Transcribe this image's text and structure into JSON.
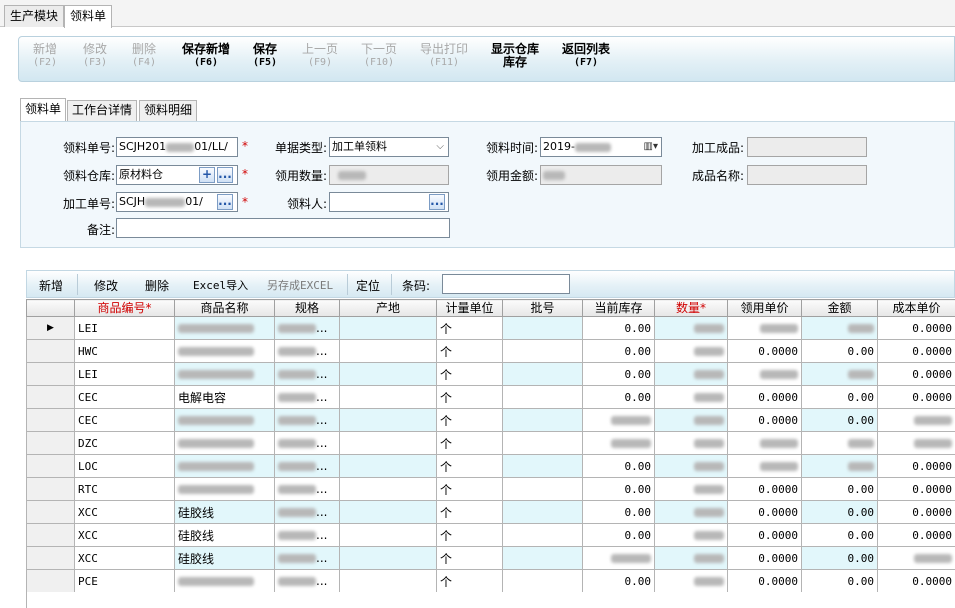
{
  "module_tabs": [
    "生产模块",
    "领料单"
  ],
  "toolbar": [
    {
      "label": "新增",
      "key": "(F2)",
      "enabled": false
    },
    {
      "label": "修改",
      "key": "(F3)",
      "enabled": false
    },
    {
      "label": "删除",
      "key": "(F4)",
      "enabled": false
    },
    {
      "label": "保存新增",
      "key": "(F6)",
      "enabled": true
    },
    {
      "label": "保存",
      "key": "(F5)",
      "enabled": true
    },
    {
      "label": "上一页",
      "key": "(F9)",
      "enabled": false
    },
    {
      "label": "下一页",
      "key": "(F10)",
      "enabled": false
    },
    {
      "label": "导出打印",
      "key": "(F11)",
      "enabled": false
    },
    {
      "label": "显示仓库",
      "key": "库存",
      "enabled": true
    },
    {
      "label": "返回列表",
      "key": "(F7)",
      "enabled": true
    }
  ],
  "form_tabs": [
    "领料单",
    "工作台详情",
    "领料明细"
  ],
  "form": {
    "order_no_label": "领料单号:",
    "order_no_prefix": "SCJH201",
    "order_no_suffix": "01/LL/",
    "doc_type_label": "单据类型:",
    "doc_type_value": "加工单领料",
    "issue_time_label": "领料时间:",
    "issue_time_value": "2019-",
    "finished_product_label": "加工成品:",
    "warehouse_label": "领料仓库:",
    "warehouse_value": "原材料仓",
    "quantity_label": "领用数量:",
    "amount_label": "领用金额:",
    "product_name_label": "成品名称:",
    "work_order_label": "加工单号:",
    "work_order_prefix": "SCJH",
    "work_order_suffix": "01/",
    "picker_label": "领料人:",
    "remark_label": "备注:",
    "required_mark": "*",
    "add_symbol": "+",
    "dots": "..."
  },
  "grid_toolbar": {
    "add": "新增",
    "edit": "修改",
    "delete": "删除",
    "excel_import": "Excel导入",
    "save_excel": "另存成EXCEL",
    "locate": "定位",
    "barcode_label": "条码:"
  },
  "columns": [
    "商品编号*",
    "商品名称",
    "规格",
    "产地",
    "计量单位",
    "批号",
    "当前库存",
    "数量*",
    "领用单价",
    "金额",
    "成本单价"
  ],
  "rows": [
    {
      "code": "LEI",
      "name": "",
      "spec": "...",
      "unit": "个",
      "stock": "0.00",
      "qty": "",
      "price": "",
      "amount": "",
      "cost": "0.0000"
    },
    {
      "code": "HWC",
      "name": "",
      "spec": "...",
      "unit": "个",
      "stock": "0.00",
      "qty": "",
      "price": "0.0000",
      "amount": "0.00",
      "cost": "0.0000"
    },
    {
      "code": "LEI",
      "name": "",
      "spec": "...",
      "unit": "个",
      "stock": "0.00",
      "qty": "",
      "price": "",
      "amount": "",
      "cost": "0.0000"
    },
    {
      "code": "CEC",
      "name": "电解电容",
      "spec": "...",
      "unit": "个",
      "stock": "0.00",
      "qty": "",
      "price": "0.0000",
      "amount": "0.00",
      "cost": "0.0000"
    },
    {
      "code": "CEC",
      "name": "",
      "spec": "...",
      "unit": "个",
      "stock": "",
      "qty": "",
      "price": "0.0000",
      "amount": "0.00",
      "cost": ""
    },
    {
      "code": "DZC",
      "name": "",
      "spec": "...",
      "unit": "个",
      "stock": "",
      "qty": "",
      "price": "",
      "amount": "",
      "cost": ""
    },
    {
      "code": "LOC",
      "name": "",
      "spec": "...",
      "unit": "个",
      "stock": "0.00",
      "qty": "",
      "price": "",
      "amount": "",
      "cost": "0.0000"
    },
    {
      "code": "RTC",
      "name": "",
      "spec": "...",
      "unit": "个",
      "stock": "0.00",
      "qty": "",
      "price": "0.0000",
      "amount": "0.00",
      "cost": "0.0000"
    },
    {
      "code": "XCC",
      "name": "硅胶线",
      "spec": "...",
      "unit": "个",
      "stock": "0.00",
      "qty": "",
      "price": "0.0000",
      "amount": "0.00",
      "cost": "0.0000"
    },
    {
      "code": "XCC",
      "name": "硅胶线",
      "spec": "...",
      "unit": "个",
      "stock": "0.00",
      "qty": "",
      "price": "0.0000",
      "amount": "0.00",
      "cost": "0.0000"
    },
    {
      "code": "XCC",
      "name": "硅胶线",
      "spec": "...",
      "unit": "个",
      "stock": "",
      "qty": "",
      "price": "0.0000",
      "amount": "0.00",
      "cost": ""
    },
    {
      "code": "PCE",
      "name": "",
      "spec": "...",
      "unit": "个",
      "stock": "0.00",
      "qty": "",
      "price": "0.0000",
      "amount": "0.00",
      "cost": "0.0000"
    }
  ],
  "selected_row": 0,
  "row_pointer": "▶",
  "colors": {
    "required": "#d00000",
    "stripe": "#e2f7fb",
    "toolbar_border": "#b9d1de"
  }
}
